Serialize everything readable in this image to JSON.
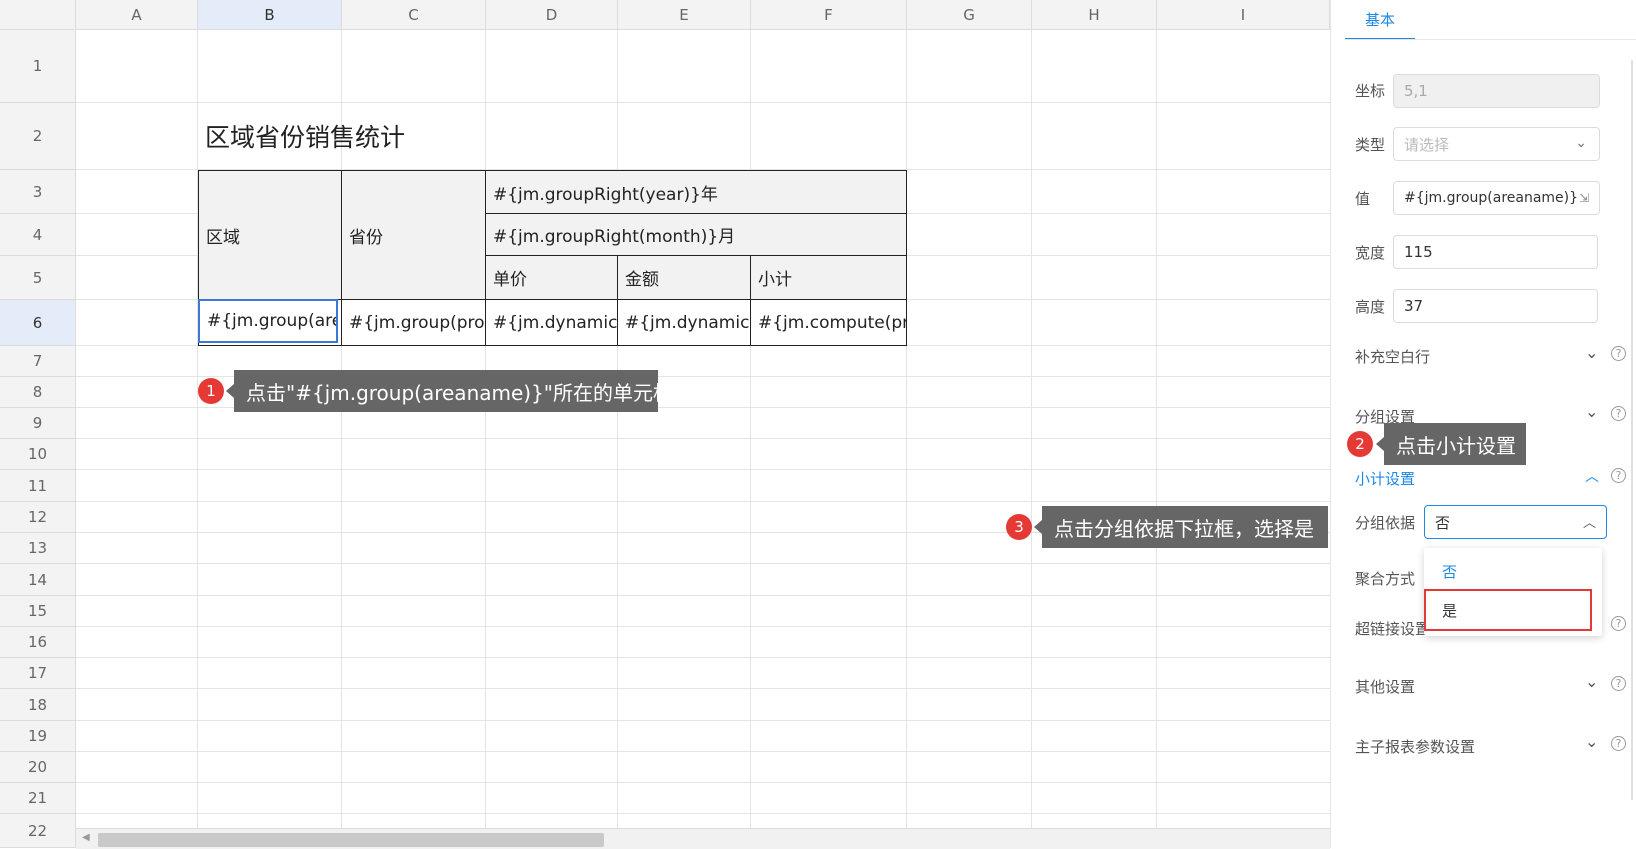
{
  "columns": [
    "A",
    "B",
    "C",
    "D",
    "E",
    "F",
    "G",
    "H",
    "I"
  ],
  "rows": [
    "1",
    "2",
    "3",
    "4",
    "5",
    "6",
    "7",
    "8",
    "9",
    "10",
    "11",
    "12",
    "13",
    "14",
    "15",
    "16",
    "17",
    "18",
    "19",
    "20",
    "21",
    "22"
  ],
  "sheet": {
    "title": "区域省份销售统计",
    "cells": {
      "region": "区域",
      "province": "省份",
      "year": "#{jm.groupRight(year)}年",
      "month": "#{jm.groupRight(month)}月",
      "unit_price": "单价",
      "amount": "金额",
      "subtotal": "小计",
      "area_group": "#{jm.group(area",
      "prov_group": "#{jm.group(provi",
      "dyn_p": "#{jm.dynamic(p",
      "dyn_a": "#{jm.dynamic(a",
      "compute": "#{jm.compute(pric"
    }
  },
  "tips": {
    "t1_num": "1",
    "t1_text": "点击\"#{jm.group(areaname)}\"所在的单元格",
    "t2_num": "2",
    "t2_text": "点击小计设置",
    "t3_num": "3",
    "t3_text": "点击分组依据下拉框，选择是"
  },
  "panel": {
    "tab": "基本",
    "coord_label": "坐标",
    "coord_value": "5,1",
    "type_label": "类型",
    "type_placeholder": "请选择",
    "value_label": "值",
    "value_value": "#{jm.group(areaname)}",
    "width_label": "宽度",
    "width_value": "115",
    "height_label": "高度",
    "height_value": "37",
    "sec_blank": "补充空白行",
    "sec_group": "分组设置",
    "sec_subtotal": "小计设置",
    "group_basis_label": "分组依据",
    "group_basis_value": "否",
    "agg_label": "聚合方式",
    "link_label": "超链接设置",
    "sec_other": "其他设置",
    "sec_master": "主子报表参数设置",
    "options": [
      "否",
      "是"
    ]
  },
  "colors": {
    "accent": "#1e88e5",
    "badge": "#e53935",
    "tooltip": "#666666"
  }
}
